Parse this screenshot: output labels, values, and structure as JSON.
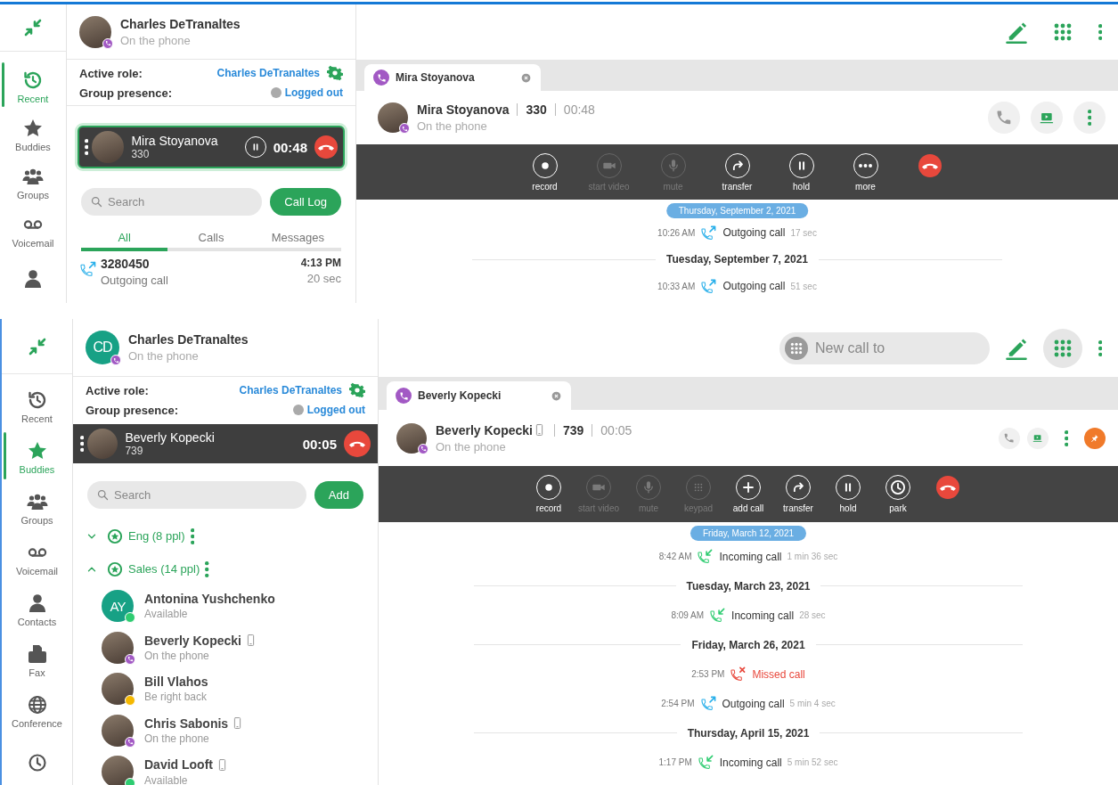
{
  "panels": [
    {
      "nav": {
        "items": [
          {
            "kind": "recent",
            "label": "Recent",
            "selected": true
          },
          {
            "kind": "buddies",
            "label": "Buddies",
            "selected": false
          },
          {
            "kind": "groups",
            "label": "Groups",
            "selected": false
          },
          {
            "kind": "voicemail",
            "label": "Voicemail",
            "selected": false
          },
          {
            "kind": "contacts",
            "selected": false
          }
        ]
      },
      "user": {
        "name": "Charles DeTranaltes",
        "status": "On the phone",
        "kind": "phone"
      },
      "active_role": {
        "label": "Active role:",
        "value": "Charles DeTranaltes"
      },
      "group_presence": {
        "label": "Group presence:",
        "value": "Logged out"
      },
      "active_call": {
        "name": "Mira Stoyanova",
        "extension": "330",
        "timer": "00:48",
        "hold_button": true,
        "highlighted": true
      },
      "search": {
        "placeholder": "Search",
        "button": "Call Log"
      },
      "tabs": [
        {
          "label": "All",
          "selected": true
        },
        {
          "label": "Calls",
          "selected": false
        },
        {
          "label": "Messages",
          "selected": false
        }
      ],
      "recent": [
        {
          "number": "3280450",
          "type": "Outgoing call",
          "kind": "outgoing",
          "time": "4:13 PM",
          "duration": "20 sec"
        }
      ],
      "topbar": {
        "dialpad_active": false
      },
      "conversation": {
        "tab": "Mira Stoyanova",
        "contact": {
          "name": "Mira Stoyanova",
          "mobile": false,
          "extension": "330",
          "timer": "00:48",
          "status": "On the phone",
          "kind": "phone"
        },
        "actions": [
          {
            "kind": "call"
          },
          {
            "kind": "video"
          },
          {
            "kind": "more"
          }
        ],
        "toolbar": [
          {
            "kind": "record",
            "label": "record",
            "disabled": false
          },
          {
            "kind": "video",
            "label": "start video",
            "disabled": true
          },
          {
            "kind": "mute",
            "label": "mute",
            "disabled": true
          },
          {
            "kind": "transfer",
            "label": "transfer",
            "disabled": false
          },
          {
            "kind": "hold",
            "label": "hold",
            "disabled": false
          },
          {
            "kind": "more",
            "label": "more",
            "disabled": false
          },
          {
            "kind": "hangup",
            "disabled": false
          }
        ],
        "sticky_date": "Thursday, September 2, 2021",
        "history": [
          {
            "kind": "outgoing",
            "time": "10:26 AM",
            "label": "Outgoing call",
            "duration": "17 sec"
          },
          {
            "kind": "date",
            "label": "Tuesday, September 7, 2021"
          },
          {
            "kind": "outgoing",
            "time": "10:33 AM",
            "label": "Outgoing call",
            "duration": "51 sec"
          }
        ]
      }
    },
    {
      "nav": {
        "items": [
          {
            "kind": "recent",
            "label": "Recent",
            "selected": false
          },
          {
            "kind": "buddies",
            "label": "Buddies",
            "selected": true
          },
          {
            "kind": "groups",
            "label": "Groups",
            "selected": false
          },
          {
            "kind": "voicemail",
            "label": "Voicemail",
            "selected": false
          },
          {
            "kind": "contacts",
            "label": "Contacts",
            "selected": false
          },
          {
            "kind": "fax",
            "label": "Fax",
            "selected": false
          },
          {
            "kind": "conference",
            "label": "Conference",
            "selected": false
          },
          {
            "kind": "park",
            "selected": false
          }
        ]
      },
      "user": {
        "name": "Charles DeTranaltes",
        "status": "On the phone",
        "kind": "phone",
        "initials": "CD"
      },
      "active_role": {
        "label": "Active role:",
        "value": "Charles DeTranaltes"
      },
      "group_presence": {
        "label": "Group presence:",
        "value": "Logged out"
      },
      "active_call": {
        "name": "Beverly Kopecki",
        "extension": "739",
        "timer": "00:05",
        "hold_button": false,
        "highlighted": false
      },
      "search": {
        "placeholder": "Search",
        "button": "Add"
      },
      "groups": [
        {
          "name": "Eng (8 ppl)",
          "expanded": false
        },
        {
          "name": "Sales (14 ppl)",
          "expanded": true,
          "children": [
            {
              "name": "Antonina Yushchenko",
              "status": "Available",
              "kind": "available",
              "initials": "AY",
              "mobile": false
            },
            {
              "name": "Beverly Kopecki",
              "status": "On the phone",
              "kind": "phone",
              "mobile": true
            },
            {
              "name": "Bill Vlahos",
              "status": "Be right back",
              "kind": "away",
              "mobile": false
            },
            {
              "name": "Chris Sabonis",
              "status": "On the phone",
              "kind": "phone",
              "mobile": true
            },
            {
              "name": "David Looft",
              "status": "Available",
              "kind": "available",
              "mobile": true
            }
          ]
        }
      ],
      "topbar": {
        "new_call_placeholder": "New call to",
        "dialpad_active": true
      },
      "conversation": {
        "tab": "Beverly Kopecki",
        "contact": {
          "name": "Beverly Kopecki",
          "mobile": true,
          "extension": "739",
          "timer": "00:05",
          "status": "On the phone",
          "kind": "phone"
        },
        "actions": [
          {
            "kind": "call"
          },
          {
            "kind": "video"
          },
          {
            "kind": "more"
          },
          {
            "kind": "pin"
          }
        ],
        "toolbar": [
          {
            "kind": "record",
            "label": "record",
            "disabled": false
          },
          {
            "kind": "video",
            "label": "start video",
            "disabled": true
          },
          {
            "kind": "mute",
            "label": "mute",
            "disabled": true
          },
          {
            "kind": "keypad",
            "label": "keypad",
            "disabled": true
          },
          {
            "kind": "add",
            "label": "add call",
            "disabled": false
          },
          {
            "kind": "transfer",
            "label": "transfer",
            "disabled": false
          },
          {
            "kind": "hold",
            "label": "hold",
            "disabled": false
          },
          {
            "kind": "park",
            "label": "park",
            "disabled": false
          },
          {
            "kind": "hangup",
            "disabled": false
          }
        ],
        "sticky_date": "Friday, March 12, 2021",
        "history": [
          {
            "kind": "incoming",
            "time": "8:42 AM",
            "label": "Incoming call",
            "duration": "1 min 36 sec"
          },
          {
            "kind": "date",
            "label": "Tuesday, March 23, 2021"
          },
          {
            "kind": "incoming",
            "time": "8:09 AM",
            "label": "Incoming call",
            "duration": "28 sec"
          },
          {
            "kind": "date",
            "label": "Friday, March 26, 2021"
          },
          {
            "kind": "missed",
            "time": "2:53 PM",
            "label": "Missed call"
          },
          {
            "kind": "outgoing",
            "time": "2:54 PM",
            "label": "Outgoing call",
            "duration": "5 min 4 sec"
          },
          {
            "kind": "date",
            "label": "Thursday, April 15, 2021"
          },
          {
            "kind": "incoming",
            "time": "1:17 PM",
            "label": "Incoming call",
            "duration": "5 min 52 sec"
          }
        ]
      }
    }
  ]
}
